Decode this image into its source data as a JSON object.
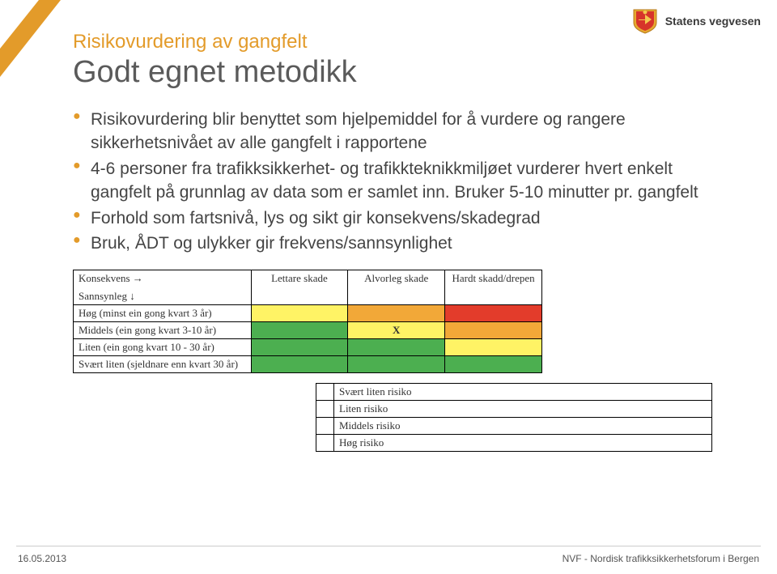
{
  "brand": {
    "name": "Statens vegvesen"
  },
  "header": {
    "supertitle": "Risikovurdering av gangfelt",
    "title": "Godt egnet metodikk"
  },
  "bullets": [
    "Risikovurdering blir benyttet som hjelpemiddel for å vurdere og rangere sikkerhetsnivået av alle gangfelt i rapportene",
    "4-6 personer fra trafikksikkerhet- og trafikkteknikkmiljøet vurderer hvert enkelt gangfelt på grunnlag av data som er samlet inn. Bruker 5-10 minutter pr. gangfelt",
    "Forhold som fartsnivå, lys og sikt gir konsekvens/skadegrad",
    "Bruk, ÅDT og ulykker gir frekvens/sannsynlighet"
  ],
  "matrix": {
    "axis_consequence": "Konsekvens →",
    "axis_probability": "Sannsynleg ↓",
    "columns": [
      "Lettare skade",
      "Alvorleg skade",
      "Hardt skadd/drepen"
    ],
    "rows": [
      {
        "label": "Høg (minst ein gong kvart 3 år)",
        "cells": [
          "yellow",
          "orange",
          "red"
        ]
      },
      {
        "label": "Middels (ein gong kvart 3-10 år)",
        "cells": [
          "green",
          "yellow_x",
          "orange"
        ]
      },
      {
        "label": "Liten (ein gong kvart 10 - 30 år)",
        "cells": [
          "green",
          "green",
          "yellow"
        ]
      },
      {
        "label": "Svært liten  (sjeldnare enn kvart 30 år)",
        "cells": [
          "green",
          "green",
          "green"
        ]
      }
    ],
    "x_mark": "X"
  },
  "legend": [
    {
      "color": "green",
      "label": "Svært liten risiko"
    },
    {
      "color": "yellow",
      "label": "Liten risiko"
    },
    {
      "color": "orange",
      "label": "Middels risiko"
    },
    {
      "color": "red",
      "label": "Høg risiko"
    }
  ],
  "footer": {
    "date": "16.05.2013",
    "caption": "NVF - Nordisk trafikksikkerhetsforum i Bergen"
  },
  "colors": {
    "green": "#4caf50",
    "yellow": "#fff365",
    "orange": "#f2a838",
    "red": "#e33c2b",
    "accent": "#e39b2a"
  }
}
